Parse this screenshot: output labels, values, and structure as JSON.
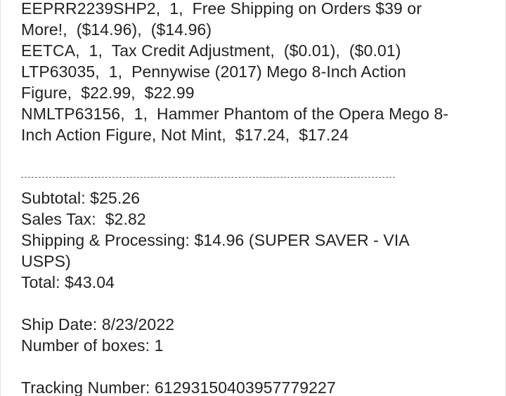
{
  "order_items": [
    {
      "sku": "EEPRR2239SHP2",
      "lines": [
        "EEPRR2239SHP2,  1,  Free Shipping on Orders $39 or",
        "More!,  ($14.96),  ($14.96)"
      ]
    },
    {
      "sku": "EETCA",
      "lines": [
        "EETCA,  1,  Tax Credit Adjustment,  ($0.01),  ($0.01)"
      ]
    },
    {
      "sku": "LTP63035",
      "lines": [
        "LTP63035,  1,  Pennywise (2017) Mego 8-Inch Action",
        "Figure,  $22.99,  $22.99"
      ]
    },
    {
      "sku": "NMLTP63156",
      "lines": [
        "NMLTP63156,  1,  Hammer Phantom of the Opera Mego 8-",
        "Inch Action Figure, Not Mint,  $17.24,  $17.24"
      ]
    }
  ],
  "divider": "----------------------------------------------------------------------------------",
  "totals": {
    "subtotal": "Subtotal: $25.26",
    "sales_tax": "Sales Tax:  $2.82",
    "shipping_line1": "Shipping & Processing: $14.96 (SUPER SAVER - VIA",
    "shipping_line2": "USPS)",
    "total": "Total: $43.04"
  },
  "shipment": {
    "ship_date": "Ship Date: 8/23/2022",
    "number_of_boxes": "Number of boxes: 1"
  },
  "tracking": {
    "tracking_number": "Tracking Number: 612931504039577792​27"
  }
}
